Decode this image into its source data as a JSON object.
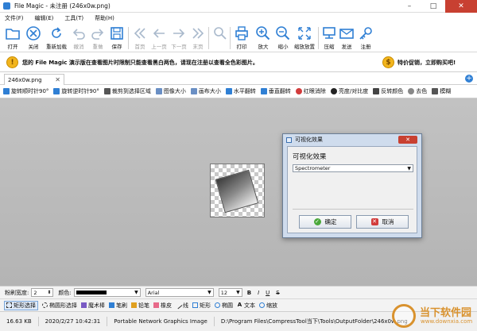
{
  "window": {
    "title": "File Magic - 未注册 (246x0w.png)",
    "minimize": "–",
    "maximize": "□",
    "close": "✕"
  },
  "menu": [
    "文件(F)",
    "编辑(E)",
    "工具(T)",
    "帮助(H)"
  ],
  "toolbar": {
    "open": "打开",
    "close": "关闭",
    "reload": "重新加载",
    "undo": "撤消",
    "redo": "重做",
    "save": "保存",
    "first": "首页",
    "prev": "上一页",
    "next": "下一页",
    "last": "末页",
    "print": "打印",
    "zoom_in": "放大",
    "zoom_out": "缩小",
    "fit": "缩放放置",
    "compress": "压缩",
    "send": "发送",
    "register": "注册"
  },
  "promo": {
    "message": "您的 File Magic 演示版在查看图片时限制只能查看黑白两色，请现在注册以查看全色彩图片。",
    "sale": "特价促销，立即购买吧!"
  },
  "tab": {
    "label": "246x0w.png",
    "close": "✕",
    "add": "+"
  },
  "image_tools": [
    "旋转顺时针90°",
    "旋转逆时针90°",
    "裁剪到选择区域",
    "图像大小",
    "画布大小",
    "水平翻转",
    "垂直翻转",
    "红眼消除",
    "亮度/对比度",
    "反转颜色",
    "去色",
    "模糊"
  ],
  "dialog": {
    "title": "可视化效果",
    "close": "✕",
    "label": "可视化效果",
    "selected_effect": "Spectrometer",
    "ok": "确定",
    "cancel": "取消"
  },
  "properties": {
    "brush_width_label": "粉刷宽度:",
    "brush_width": "2",
    "color_label": "颜色:",
    "font": "Arial",
    "font_size": "12",
    "bold": "B",
    "italic": "I",
    "underline": "U",
    "strike": "S"
  },
  "draw_tools": [
    "矩形选择",
    "椭圆形选择",
    "魔术棒",
    "笔刷",
    "铅笔",
    "橡皮",
    "线",
    "矩形",
    "椭圆",
    "文本",
    "缩放"
  ],
  "status": {
    "size": "16.63 KB",
    "date": "2020/2/27 10:42:31",
    "type": "Portable Network Graphics Image",
    "path": "D:\\Program Files\\CompressTool当下\\Tools\\OutputFolder\\246x0w.png"
  },
  "watermark": {
    "name": "当下软件园",
    "url": "www.downxia.com"
  },
  "colors": {
    "accent": "#2f7fd4",
    "close_red": "#c84031",
    "promo_gold": "#f2b51d",
    "watermark": "#d9922e"
  }
}
